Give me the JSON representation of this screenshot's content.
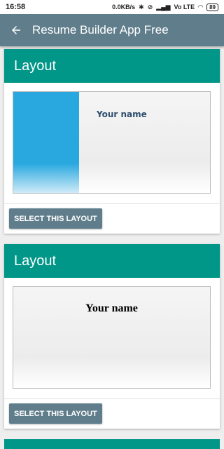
{
  "status": {
    "time": "16:58",
    "network_speed": "0.0KB/s",
    "network_type": "Vo LTE",
    "battery": "89"
  },
  "appbar": {
    "title": "Resume Builder App Free",
    "back_icon": "arrow-left-icon"
  },
  "cards": [
    {
      "header": "Layout",
      "preview_name": "Your name",
      "button_label": "SELECT THIS LAYOUT"
    },
    {
      "header": "Layout",
      "preview_name": "Your name",
      "button_label": "SELECT THIS LAYOUT"
    }
  ],
  "colors": {
    "appbar": "#607d8b",
    "card_header": "#009688",
    "button": "#607d8b",
    "template_sidebar": "#29a8df"
  }
}
